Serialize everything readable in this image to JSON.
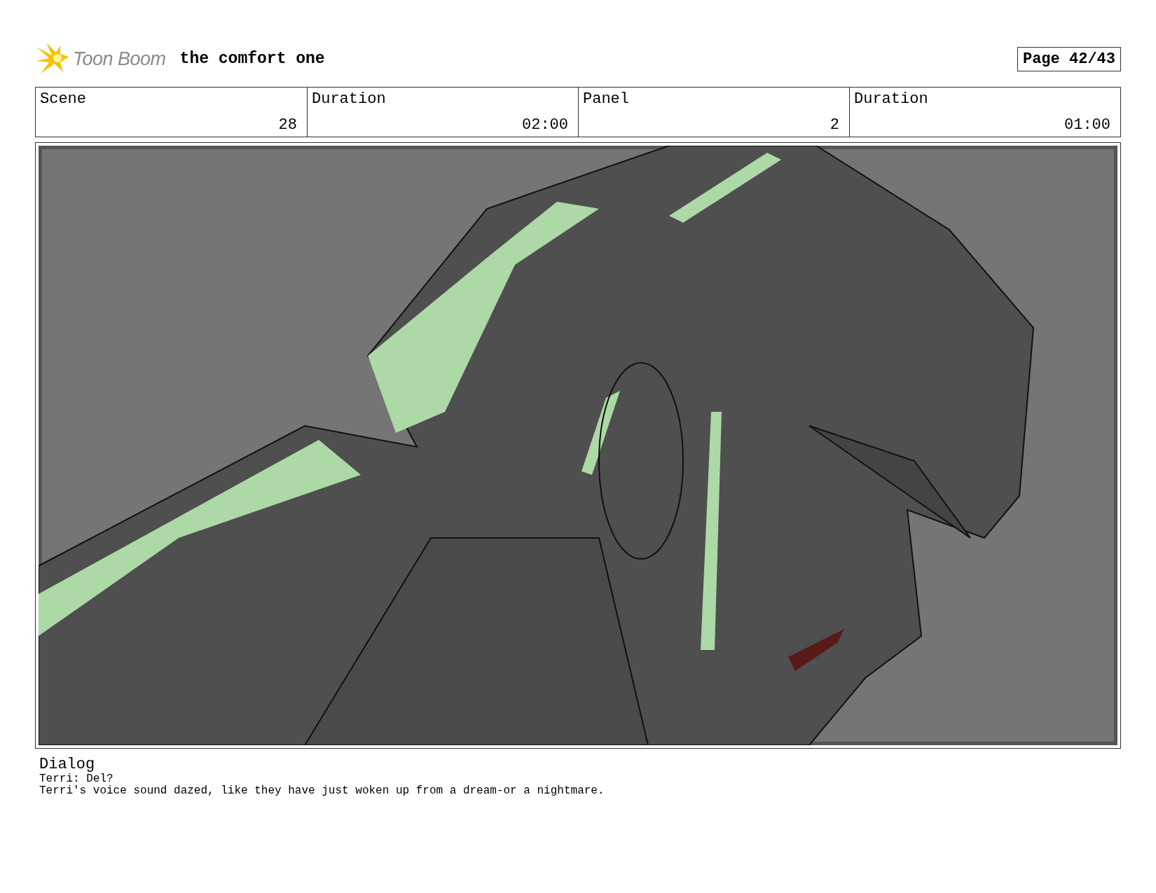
{
  "header": {
    "logo_text": "Toon Boom",
    "title": "the comfort one",
    "page": "Page 42/43"
  },
  "info": [
    {
      "label": "Scene",
      "value": "28"
    },
    {
      "label": "Duration",
      "value": "02:00"
    },
    {
      "label": "Panel",
      "value": "2"
    },
    {
      "label": "Duration",
      "value": "01:00"
    }
  ],
  "dialog": {
    "heading": "Dialog",
    "lines": [
      "Terri: Del?",
      "Terri's voice sound dazed, like they have just woken up from a dream-or a nightmare."
    ]
  }
}
